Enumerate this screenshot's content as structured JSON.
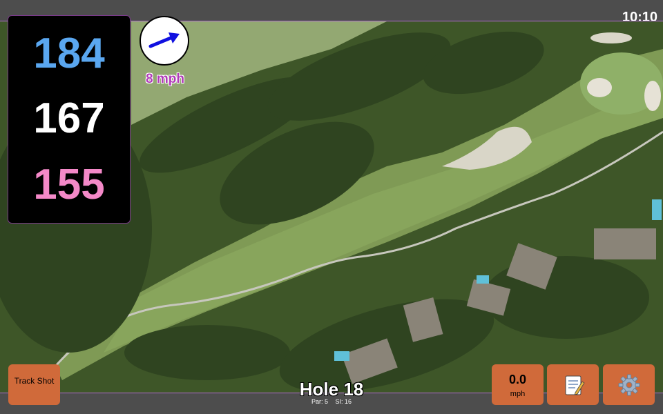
{
  "status": {
    "time": "10:10"
  },
  "distances": {
    "back": "184",
    "middle": "167",
    "front": "155"
  },
  "wind": {
    "speed": "8 mph",
    "direction_icon": "wind-arrow-icon"
  },
  "buttons": {
    "track_shot_label": "Track Shot",
    "speed_value": "0.0",
    "speed_unit": "mph",
    "notes_icon": "notepad-icon",
    "settings_icon": "gear-icon"
  },
  "hole": {
    "title": "Hole 18",
    "par": "Par: 5",
    "si": "SI: 16"
  },
  "colors": {
    "back": "#5aa7f0",
    "middle": "#ffffff",
    "front": "#f489c8",
    "button": "#d06a3a",
    "wind_text": "#b03ab8"
  }
}
